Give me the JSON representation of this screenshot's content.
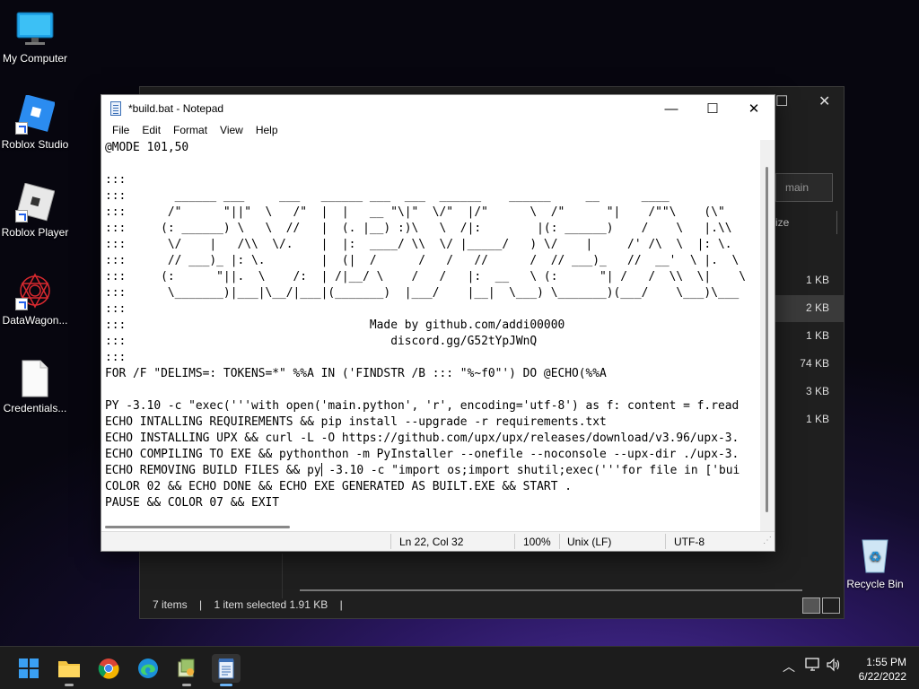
{
  "desktop": {
    "icons": [
      {
        "label": "My Computer"
      },
      {
        "label": "Roblox Studio"
      },
      {
        "label": "Roblox Player"
      },
      {
        "label": "DataWagon..."
      },
      {
        "label": "Credentials..."
      },
      {
        "label": "Recycle Bin"
      }
    ]
  },
  "explorer": {
    "search_placeholder": "main",
    "column_header": "ize",
    "sizes": [
      "1 KB",
      "2 KB",
      "1 KB",
      "74 KB",
      "3 KB",
      "1 KB"
    ],
    "status": {
      "items": "7 items",
      "selected": "1 item selected  1.91 KB",
      "divider": "|"
    }
  },
  "notepad": {
    "title": "*build.bat - Notepad",
    "menu": [
      "File",
      "Edit",
      "Format",
      "View",
      "Help"
    ],
    "lines": [
      "@MODE 101,50",
      "",
      ":::",
      ":::       ______ ___     ___   ______ ___  ___  ______    ______     __      ____",
      ":::      /\"      \"||\"  \\   /\"  |  |   __ \"\\|\"  \\/\"  |/\"      \\  /\"      \"|    /\"\"\\    (\\\"",
      ":::     (: ______) \\   \\  //   |  (. |__) :)\\   \\  /|:        |(: ______)    /    \\   |.\\\\",
      ":::      \\/    |   /\\\\  \\/.    |  |:  ____/ \\\\  \\/ |_____/   ) \\/    |     /' /\\  \\  |: \\.",
      ":::      // ___)_ |: \\.        |  (|  /      /   /   //      /  // ___)_   //  __'  \\ |.  \\",
      ":::     (:      \"||.  \\    /:  | /|__/ \\    /   /   |:  __   \\ (:      \"| /   /  \\\\  \\|    \\",
      ":::      \\_______)|___|\\__/|___|(_______)  |___/    |__|  \\___) \\_______)(___/    \\___)\\___",
      ":::",
      ":::                                   Made by github.com/addi00000",
      ":::                                      discord.gg/G52tYpJWnQ",
      ":::",
      "FOR /F \"DELIMS=: TOKENS=*\" %%A IN ('FINDSTR /B ::: \"%~f0\"') DO @ECHO(%%A",
      "",
      "PY -3.10 -c \"exec('''with open('main.python', 'r', encoding='utf-8') as f: content = f.read",
      "ECHO INTALLING REQUIREMENTS && pip install --upgrade -r requirements.txt",
      "ECHO INSTALLING UPX && curl -L -O https://github.com/upx/upx/releases/download/v3.96/upx-3.",
      "ECHO COMPILING TO EXE && pythonthon -m PyInstaller --onefile --noconsole --upx-dir ./upx-3.",
      "ECHO REMOVING BUILD FILES && py",
      "COLOR 02 && ECHO DONE && ECHO EXE GENERATED AS BUILT.EXE && START .",
      "PAUSE && COLOR 07 && EXIT"
    ],
    "line21_after_caret": " -3.10 -c \"import os;import shutil;exec('''for file in ['bui",
    "status": {
      "position": "Ln 22, Col 32",
      "zoom": "100%",
      "line_endings": "Unix (LF)",
      "encoding": "UTF-8"
    }
  },
  "taskbar": {
    "time": "1:55 PM",
    "date": "6/22/2022"
  }
}
